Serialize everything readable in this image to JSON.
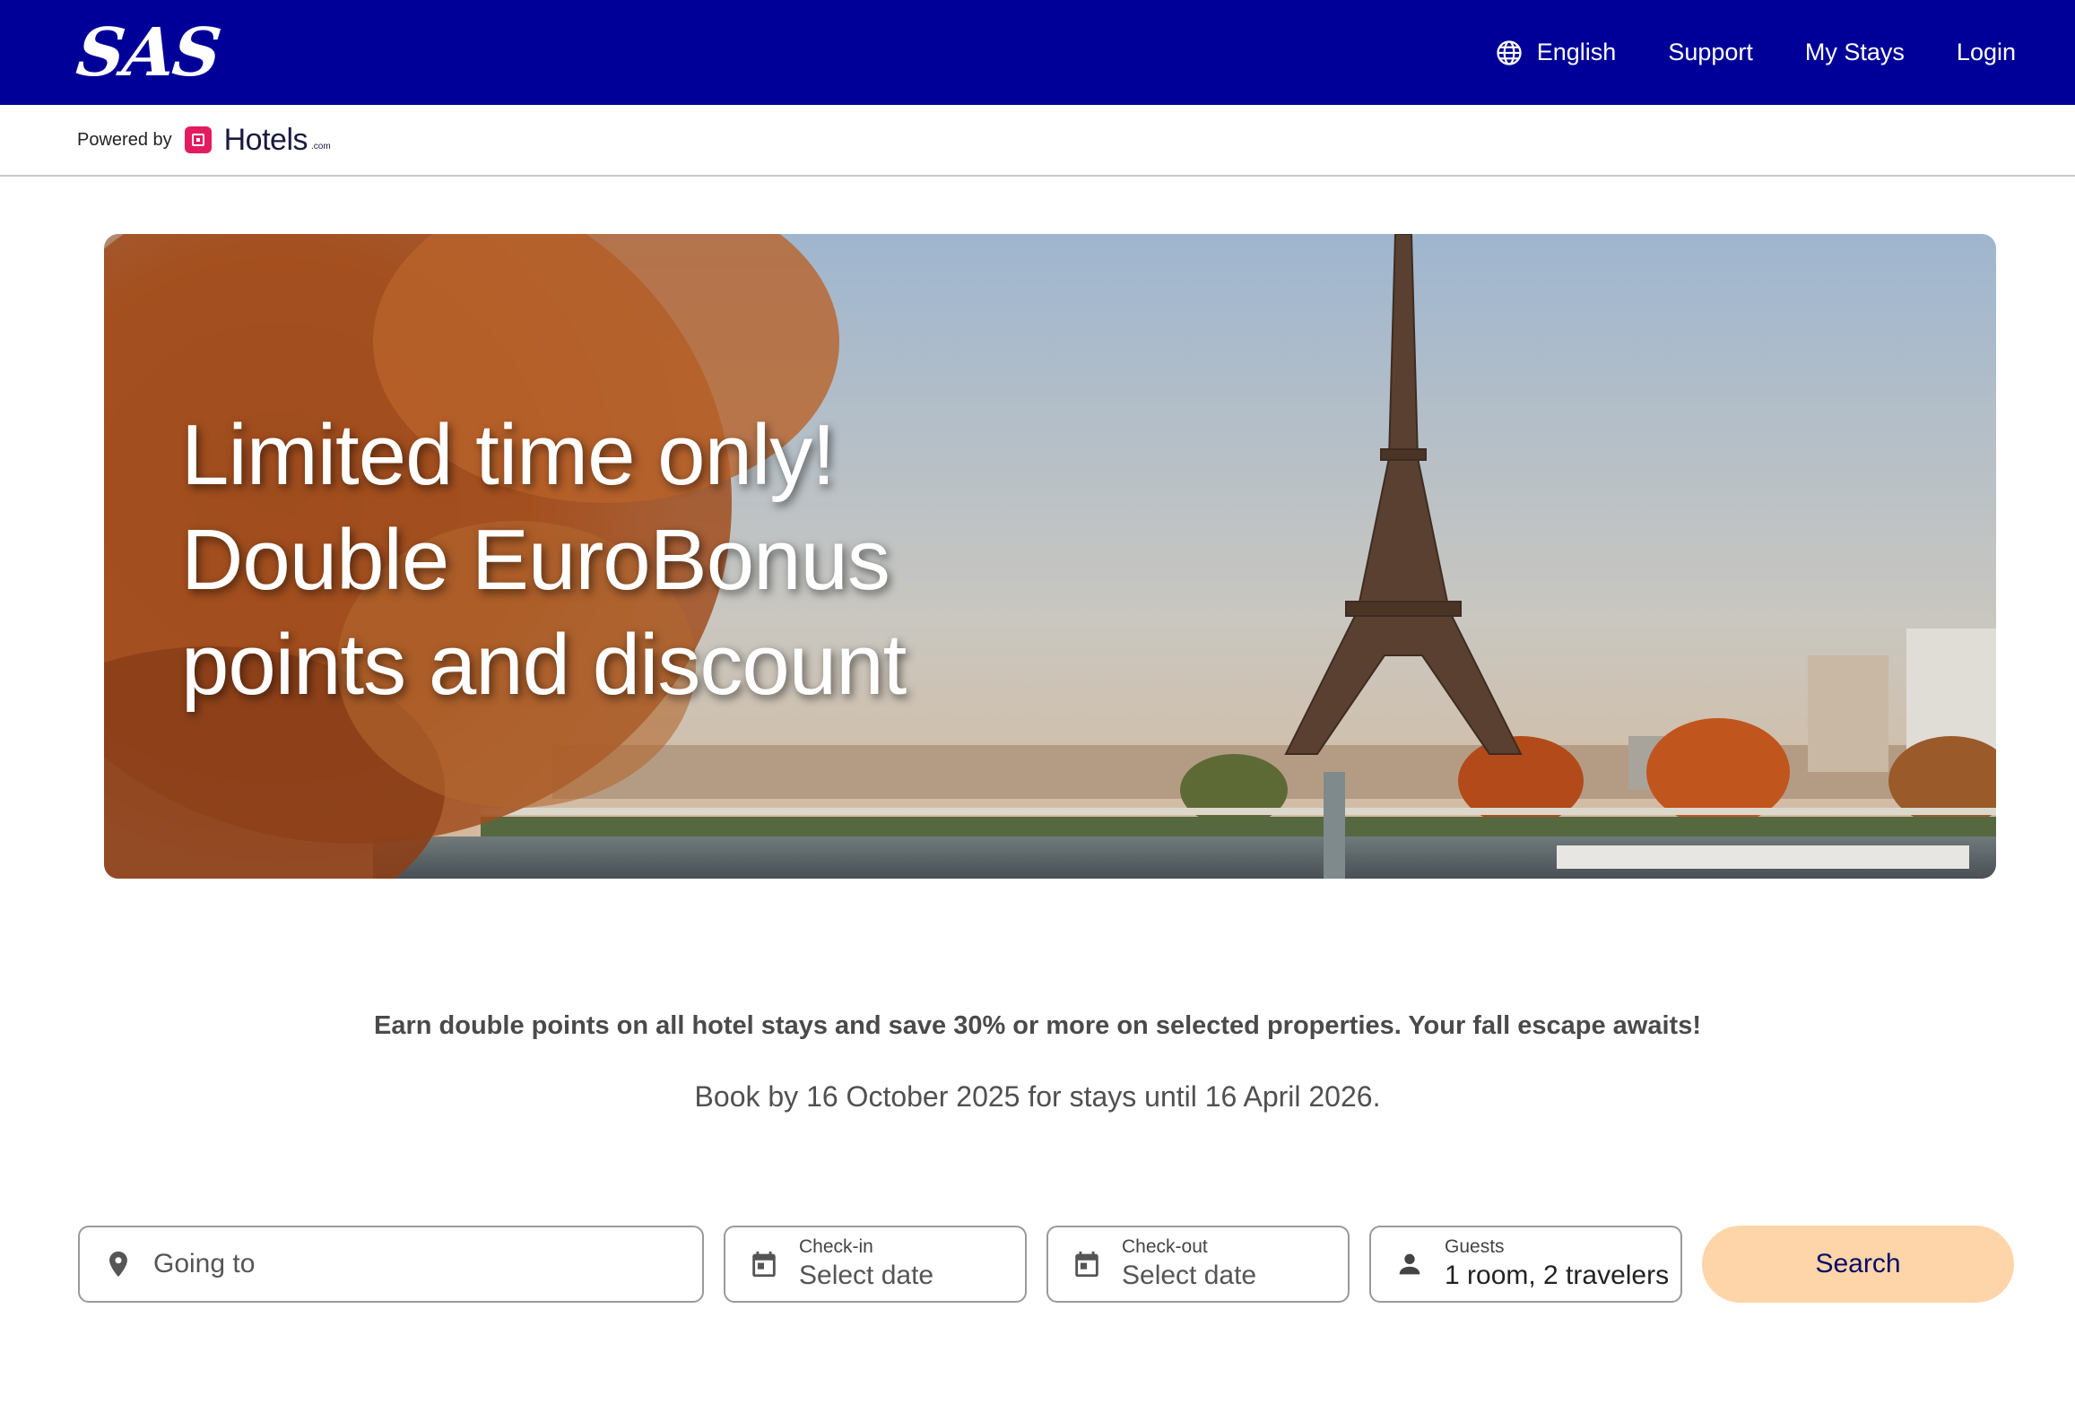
{
  "header": {
    "brand": "SAS",
    "nav": {
      "language": "English",
      "support": "Support",
      "my_stays": "My Stays",
      "login": "Login"
    },
    "background_color": "#000099"
  },
  "powered_by": {
    "label": "Powered by",
    "partner": "Hotels",
    "partner_suffix": ".com"
  },
  "hero": {
    "heading_line1": "Limited time only!",
    "heading_line2": "Double EuroBonus",
    "heading_line3": "points and discount"
  },
  "promo": {
    "description": "Earn double points on all hotel stays and save 30% or more on selected properties. Your fall escape awaits!",
    "deadline": "Book by 16 October 2025 for stays until 16 April 2026."
  },
  "search": {
    "destination_placeholder": "Going to",
    "checkin_label": "Check-in",
    "checkin_value": "Select date",
    "checkout_label": "Check-out",
    "checkout_value": "Select date",
    "guests_label": "Guests",
    "guests_value": "1 room, 2 travelers",
    "button_label": "Search",
    "button_color": "#fdd5a8"
  },
  "icons": {
    "language": "globe-icon",
    "destination": "map-pin-icon",
    "checkin": "calendar-icon",
    "checkout": "calendar-icon",
    "guests": "person-icon"
  }
}
